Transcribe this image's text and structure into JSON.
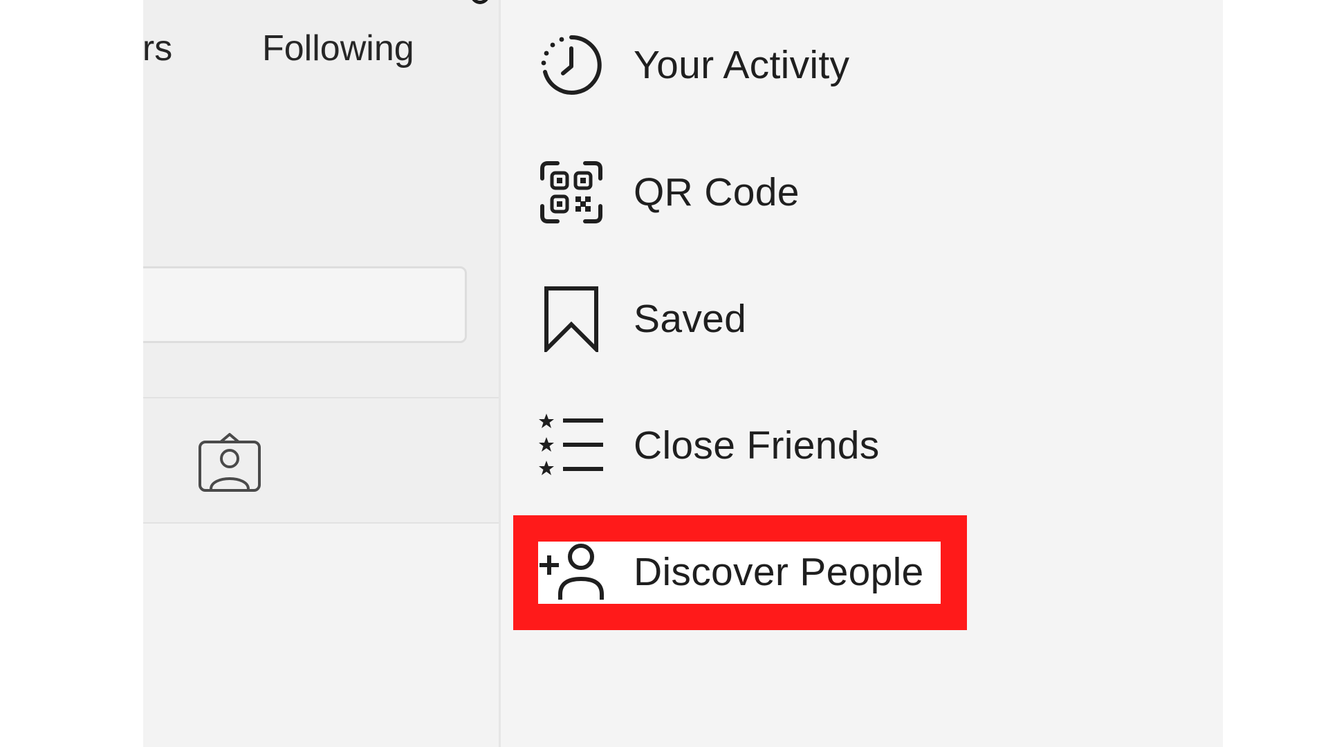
{
  "profile": {
    "stats": {
      "followers_label": "ers",
      "following_label": "Following"
    },
    "tabs": [
      {
        "icon": "tagged-person-icon"
      }
    ]
  },
  "menu": {
    "items": [
      {
        "label": "Your Activity",
        "icon": "activity-clock-icon"
      },
      {
        "label": "QR Code",
        "icon": "qr-code-icon"
      },
      {
        "label": "Saved",
        "icon": "bookmark-icon"
      },
      {
        "label": "Close Friends",
        "icon": "star-list-icon"
      },
      {
        "label": "Discover People",
        "icon": "add-person-icon",
        "highlighted": true
      }
    ]
  },
  "colors": {
    "highlight": "#ff1a1a",
    "menu_background": "#f4f4f4",
    "panel_background": "#efefef",
    "text": "#1f1f1f"
  }
}
